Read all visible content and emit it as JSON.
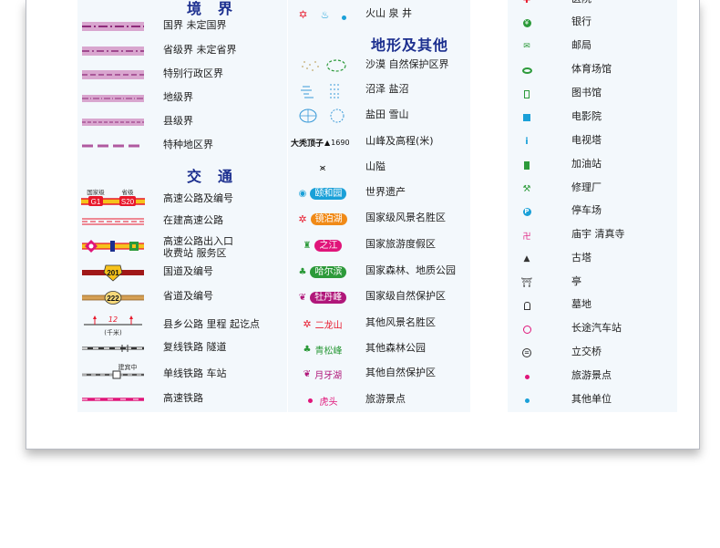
{
  "colors": {
    "heading": "#1c2f8f",
    "border": "#8e2a7a",
    "railway": "#e0157a",
    "highway_red": "#e8182b",
    "highway_yellow": "#f6c21c",
    "park_green": "#2c9a3a"
  },
  "col1": {
    "heading1": "境　界",
    "boundaries": [
      {
        "label": "国界  未定国界",
        "icon": "national-border-icon"
      },
      {
        "label": "省级界  未定省界",
        "icon": "provincial-border-icon"
      },
      {
        "label": "特别行政区界",
        "icon": "sar-border-icon"
      },
      {
        "label": "地级界",
        "icon": "prefecture-border-icon"
      },
      {
        "label": "县级界",
        "icon": "county-border-icon"
      },
      {
        "label": "特种地区界",
        "icon": "special-area-border-icon"
      }
    ],
    "heading2": "交　通",
    "transport": [
      {
        "label": "高速公路及编号",
        "icon": "expressway-icon",
        "top_left": "国家级",
        "top_right": "省级",
        "code_left": "G1",
        "code_right": "S20"
      },
      {
        "label": "在建高速公路",
        "icon": "expressway-under-construction-icon"
      },
      {
        "label": "高速公路出入口",
        "label2": "收费站  服务区",
        "icon": "expressway-exit-icon"
      },
      {
        "label": "国道及编号",
        "icon": "national-road-icon",
        "code": "201"
      },
      {
        "label": "省道及编号",
        "icon": "provincial-road-icon",
        "code": "222"
      },
      {
        "label": "县乡公路  里程  起讫点",
        "icon": "county-road-icon",
        "km": "12",
        "unit": "(千米)"
      },
      {
        "label": "复线铁路  隧道",
        "icon": "double-railway-icon"
      },
      {
        "label": "单线铁路  车站",
        "icon": "single-railway-icon",
        "station": "建宾中"
      },
      {
        "label": "高速铁路",
        "icon": "high-speed-railway-icon"
      }
    ]
  },
  "col2": {
    "volcano_label": "火山  泉  井",
    "heading": "地形及其他",
    "items": [
      {
        "label": "沙漠  自然保护区界",
        "icon": "desert-icon"
      },
      {
        "label": "沼泽  盐沼",
        "icon": "marsh-icon"
      },
      {
        "label": "盐田  雪山",
        "icon": "salt-field-icon"
      },
      {
        "label": "山峰及高程(米)",
        "icon": "peak-icon",
        "peak_name": "大秃顶子",
        "peak_height": "1690"
      },
      {
        "label": "山隘",
        "icon": "mountain-pass-icon"
      },
      {
        "label": "世界遗产",
        "icon": "world-heritage-icon",
        "tag": "颐和园",
        "tag_color": "#1aa0d8"
      },
      {
        "label": "国家级风景名胜区",
        "icon": "national-scenic-icon",
        "tag": "镜泊湖",
        "tag_color": "#f08a17"
      },
      {
        "label": "国家旅游度假区",
        "icon": "national-resort-icon",
        "tag": "之江",
        "tag_color": "#e0157a"
      },
      {
        "label": "国家森林、地质公园",
        "icon": "national-forest-icon",
        "tag": "哈尔滨",
        "tag_color": "#2c9a3a"
      },
      {
        "label": "国家级自然保护区",
        "icon": "national-reserve-icon",
        "tag": "牡丹峰",
        "tag_color": "#b0177a"
      },
      {
        "label": "其他风景名胜区",
        "icon": "other-scenic-icon",
        "text": "二龙山",
        "text_color": "#e8182b"
      },
      {
        "label": "其他森林公园",
        "icon": "other-forest-icon",
        "text": "青松峰",
        "text_color": "#2c9a3a"
      },
      {
        "label": "其他自然保护区",
        "icon": "other-reserve-icon",
        "text": "月牙湖",
        "text_color": "#b0177a"
      },
      {
        "label": "旅游景点",
        "icon": "tourist-spot-icon",
        "text": "虎头",
        "text_color": "#e0157a"
      }
    ]
  },
  "col3": {
    "items": [
      {
        "label": "医院",
        "icon": "hospital-icon"
      },
      {
        "label": "银行",
        "icon": "bank-icon"
      },
      {
        "label": "邮局",
        "icon": "post-office-icon"
      },
      {
        "label": "体育场馆",
        "icon": "stadium-icon"
      },
      {
        "label": "图书馆",
        "icon": "library-icon"
      },
      {
        "label": "电影院",
        "icon": "cinema-icon"
      },
      {
        "label": "电视塔",
        "icon": "tv-tower-icon"
      },
      {
        "label": "加油站",
        "icon": "gas-station-icon"
      },
      {
        "label": "修理厂",
        "icon": "repair-shop-icon"
      },
      {
        "label": "停车场",
        "icon": "parking-icon",
        "glyph": "P"
      },
      {
        "label": "庙宇  清真寺",
        "icon": "temple-icon"
      },
      {
        "label": "古塔",
        "icon": "pagoda-icon"
      },
      {
        "label": "亭",
        "icon": "pavilion-icon"
      },
      {
        "label": "墓地",
        "icon": "cemetery-icon"
      },
      {
        "label": "长途汽车站",
        "icon": "bus-station-icon"
      },
      {
        "label": "立交桥",
        "icon": "interchange-icon"
      },
      {
        "label": "旅游景点",
        "icon": "tourist-spot-icon"
      },
      {
        "label": "其他单位",
        "icon": "other-unit-icon"
      }
    ]
  }
}
